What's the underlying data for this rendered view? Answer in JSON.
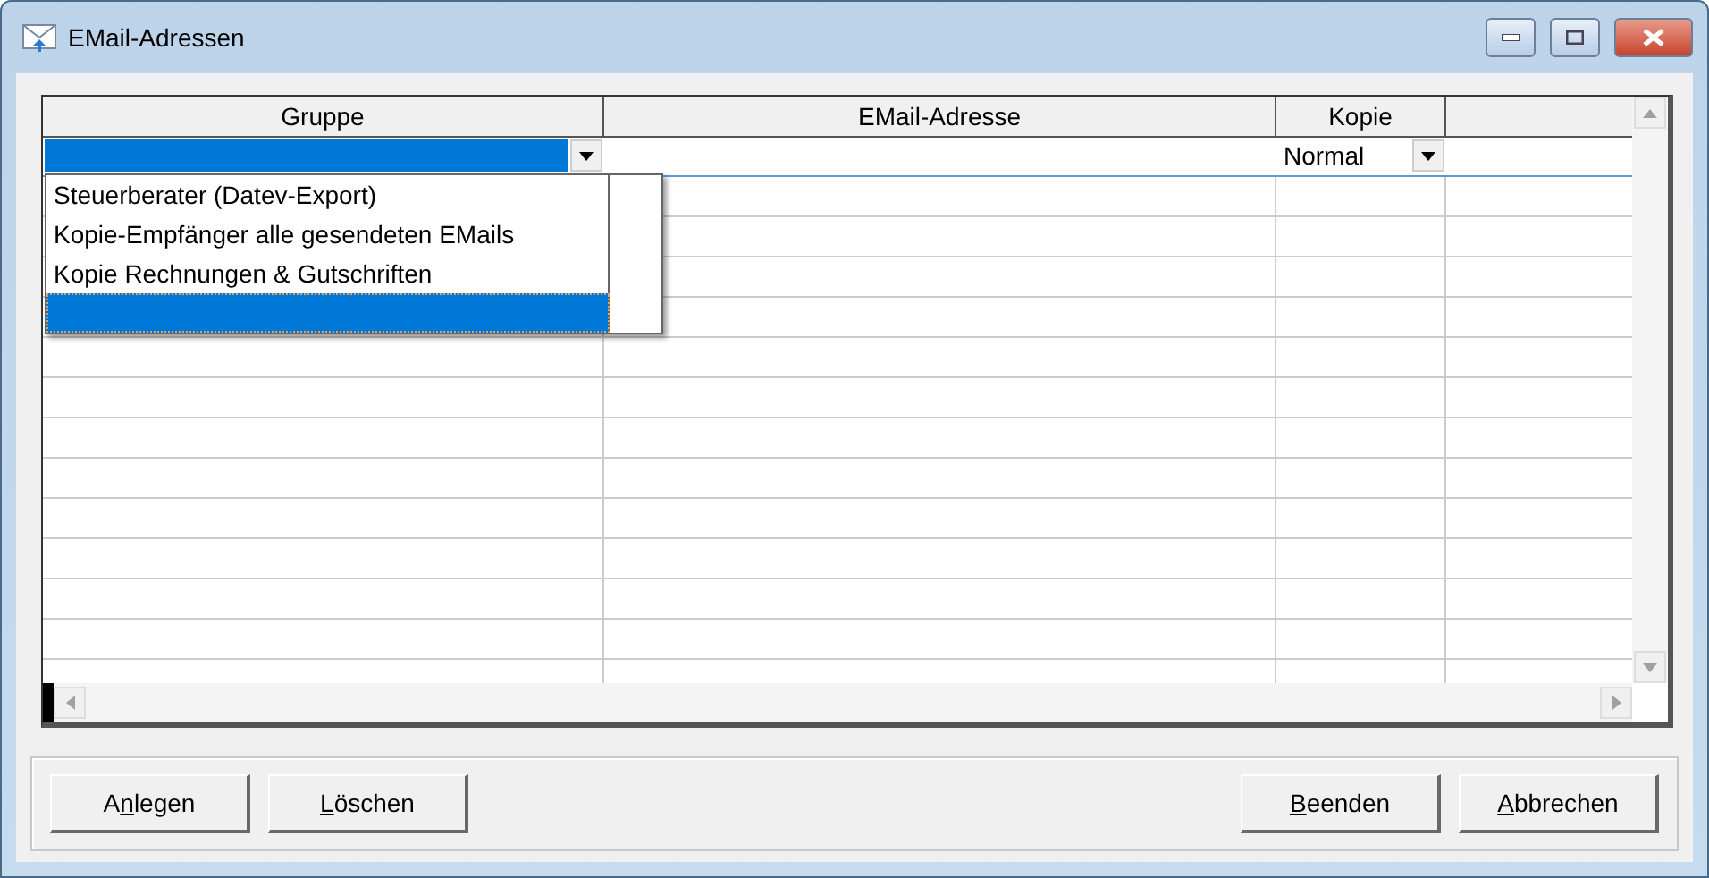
{
  "window": {
    "title": "EMail-Adressen"
  },
  "table": {
    "columns": [
      {
        "label": "Gruppe"
      },
      {
        "label": "EMail-Adresse"
      },
      {
        "label": "Kopie"
      }
    ],
    "edit_row": {
      "gruppe_selected": true,
      "kopie": "Normal"
    },
    "dropdown": {
      "items": [
        {
          "label": "Steuerberater (Datev-Export)",
          "selected": false
        },
        {
          "label": "Kopie-Empfänger alle gesendeten EMails",
          "selected": false
        },
        {
          "label": "Kopie Rechnungen & Gutschriften",
          "selected": false
        },
        {
          "selected": true
        }
      ]
    }
  },
  "left_buttons": [
    {
      "before": "A",
      "mnemonic": "n",
      "after": "legen"
    },
    {
      "mnemonic": "L",
      "after": "öschen"
    }
  ],
  "right_buttons": [
    {
      "mnemonic": "B",
      "after": "eenden"
    },
    {
      "mnemonic": "A",
      "after": "bbrechen"
    }
  ]
}
